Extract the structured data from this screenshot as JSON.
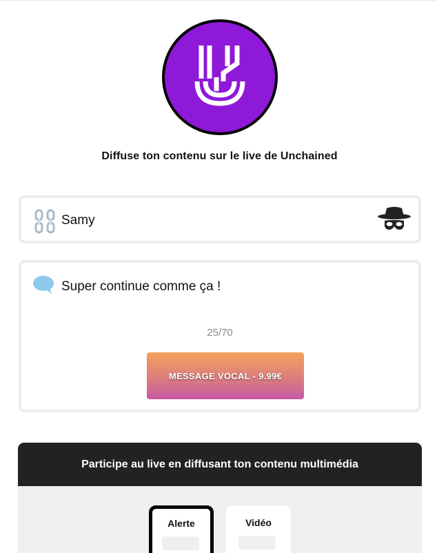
{
  "brand": {
    "logo_icon": "unchained-logo",
    "logo_color": "#8e19d9",
    "tagline": "Diffuse ton contenu sur le live de Unchained"
  },
  "name_field": {
    "icon": "chain-icon",
    "value": "Samy",
    "anonymous_icon": "spy-icon"
  },
  "message_field": {
    "icon": "speech-bubble-icon",
    "value": "Super continue comme ça !",
    "counter": "25/70"
  },
  "vocal_button": {
    "label": "MESSAGE VOCAL - 9.99€"
  },
  "media": {
    "header": "Participe au live en diffusant ton contenu multimédia",
    "tabs": [
      {
        "label": "Alerte",
        "selected": true
      },
      {
        "label": "Vidéo",
        "selected": false
      }
    ]
  }
}
